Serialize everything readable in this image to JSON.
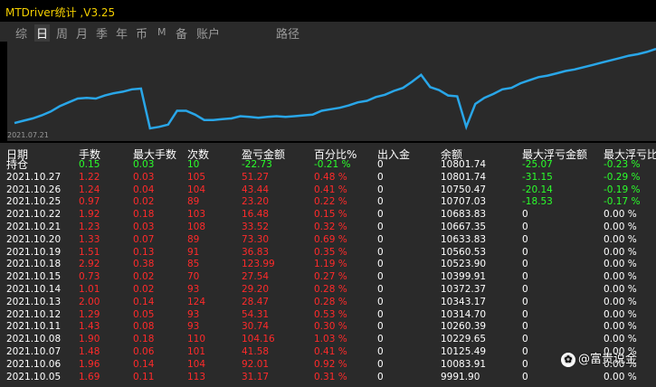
{
  "window": {
    "title": "MTDriver统计 ,V3.25"
  },
  "tabs": [
    {
      "label": "综",
      "active": false
    },
    {
      "label": "日",
      "active": true
    },
    {
      "label": "周",
      "active": false
    },
    {
      "label": "月",
      "active": false
    },
    {
      "label": "季",
      "active": false
    },
    {
      "label": "年",
      "active": false
    },
    {
      "label": "币",
      "active": false
    },
    {
      "label": "M",
      "active": false
    },
    {
      "label": "备",
      "active": false
    },
    {
      "label": "账户",
      "active": false
    },
    {
      "label": "路径",
      "active": false
    }
  ],
  "chart_data": {
    "type": "line",
    "x_start_label": "2021.07.21",
    "values": [
      1,
      1.3,
      1.6,
      2.0,
      2.5,
      3.2,
      3.7,
      4.2,
      4.3,
      4.2,
      4.6,
      4.9,
      5.1,
      5.4,
      5.5,
      0.3,
      0.5,
      0.8,
      2.6,
      2.6,
      2.1,
      1.4,
      1.4,
      1.5,
      1.6,
      1.9,
      1.8,
      1.7,
      1.8,
      1.9,
      1.8,
      1.9,
      2.0,
      2.1,
      2.6,
      2.8,
      3.0,
      3.3,
      3.7,
      3.9,
      4.4,
      4.7,
      5.2,
      5.6,
      6.4,
      7.3,
      5.7,
      5.3,
      4.6,
      4.5,
      0.5,
      3.5,
      4.3,
      4.8,
      5.4,
      5.6,
      6.2,
      6.6,
      7.0,
      7.2,
      7.5,
      7.8,
      8.0,
      8.3,
      8.6,
      8.9,
      9.2,
      9.5,
      9.8,
      10.0,
      10.3,
      10.7
    ],
    "line_color": "#29a6e8",
    "grid": false
  },
  "table": {
    "headers": [
      "日期",
      "手数",
      "最大手数",
      "次数",
      "盈亏金额",
      "百分比%",
      "出入金",
      "余额",
      "最大浮亏金额",
      "最大浮亏比"
    ],
    "rows": [
      {
        "date": "持仓",
        "lots": "0.15",
        "max_lots": "0.03",
        "count": "10",
        "pnl": "-22.73",
        "pct": "-0.21 %",
        "cash": "0",
        "balance": "10801.74",
        "max_dd": "-25.07",
        "max_dd_pct": "-0.23 %",
        "color": "green",
        "dd_color": "green"
      },
      {
        "date": "2021.10.27",
        "lots": "1.22",
        "max_lots": "0.03",
        "count": "105",
        "pnl": "51.27",
        "pct": "0.48 %",
        "cash": "0",
        "balance": "10801.74",
        "max_dd": "-31.15",
        "max_dd_pct": "-0.29 %",
        "color": "red",
        "dd_color": "green"
      },
      {
        "date": "2021.10.26",
        "lots": "1.24",
        "max_lots": "0.04",
        "count": "104",
        "pnl": "43.44",
        "pct": "0.41 %",
        "cash": "0",
        "balance": "10750.47",
        "max_dd": "-20.14",
        "max_dd_pct": "-0.19 %",
        "color": "red",
        "dd_color": "green"
      },
      {
        "date": "2021.10.25",
        "lots": "0.97",
        "max_lots": "0.02",
        "count": "89",
        "pnl": "23.20",
        "pct": "0.22 %",
        "cash": "0",
        "balance": "10707.03",
        "max_dd": "-18.53",
        "max_dd_pct": "-0.17 %",
        "color": "red",
        "dd_color": "green"
      },
      {
        "date": "2021.10.22",
        "lots": "1.92",
        "max_lots": "0.18",
        "count": "103",
        "pnl": "16.48",
        "pct": "0.15 %",
        "cash": "0",
        "balance": "10683.83",
        "max_dd": "0",
        "max_dd_pct": "0.00 %",
        "color": "red",
        "dd_color": "white"
      },
      {
        "date": "2021.10.21",
        "lots": "1.23",
        "max_lots": "0.03",
        "count": "108",
        "pnl": "33.52",
        "pct": "0.32 %",
        "cash": "0",
        "balance": "10667.35",
        "max_dd": "0",
        "max_dd_pct": "0.00 %",
        "color": "red",
        "dd_color": "white"
      },
      {
        "date": "2021.10.20",
        "lots": "1.33",
        "max_lots": "0.07",
        "count": "89",
        "pnl": "73.30",
        "pct": "0.69 %",
        "cash": "0",
        "balance": "10633.83",
        "max_dd": "0",
        "max_dd_pct": "0.00 %",
        "color": "red",
        "dd_color": "white"
      },
      {
        "date": "2021.10.19",
        "lots": "1.51",
        "max_lots": "0.13",
        "count": "91",
        "pnl": "36.83",
        "pct": "0.35 %",
        "cash": "0",
        "balance": "10560.53",
        "max_dd": "0",
        "max_dd_pct": "0.00 %",
        "color": "red",
        "dd_color": "white"
      },
      {
        "date": "2021.10.18",
        "lots": "2.92",
        "max_lots": "0.38",
        "count": "85",
        "pnl": "123.99",
        "pct": "1.19 %",
        "cash": "0",
        "balance": "10523.90",
        "max_dd": "0",
        "max_dd_pct": "0.00 %",
        "color": "red",
        "dd_color": "white"
      },
      {
        "date": "2021.10.15",
        "lots": "0.73",
        "max_lots": "0.02",
        "count": "70",
        "pnl": "27.54",
        "pct": "0.27 %",
        "cash": "0",
        "balance": "10399.91",
        "max_dd": "0",
        "max_dd_pct": "0.00 %",
        "color": "red",
        "dd_color": "white"
      },
      {
        "date": "2021.10.14",
        "lots": "1.01",
        "max_lots": "0.02",
        "count": "93",
        "pnl": "29.20",
        "pct": "0.28 %",
        "cash": "0",
        "balance": "10372.37",
        "max_dd": "0",
        "max_dd_pct": "0.00 %",
        "color": "red",
        "dd_color": "white"
      },
      {
        "date": "2021.10.13",
        "lots": "2.00",
        "max_lots": "0.14",
        "count": "124",
        "pnl": "28.47",
        "pct": "0.28 %",
        "cash": "0",
        "balance": "10343.17",
        "max_dd": "0",
        "max_dd_pct": "0.00 %",
        "color": "red",
        "dd_color": "white"
      },
      {
        "date": "2021.10.12",
        "lots": "1.29",
        "max_lots": "0.05",
        "count": "93",
        "pnl": "54.31",
        "pct": "0.53 %",
        "cash": "0",
        "balance": "10314.70",
        "max_dd": "0",
        "max_dd_pct": "0.00 %",
        "color": "red",
        "dd_color": "white"
      },
      {
        "date": "2021.10.11",
        "lots": "1.43",
        "max_lots": "0.08",
        "count": "93",
        "pnl": "30.74",
        "pct": "0.30 %",
        "cash": "0",
        "balance": "10260.39",
        "max_dd": "0",
        "max_dd_pct": "0.00 %",
        "color": "red",
        "dd_color": "white"
      },
      {
        "date": "2021.10.08",
        "lots": "1.90",
        "max_lots": "0.18",
        "count": "110",
        "pnl": "104.16",
        "pct": "1.03 %",
        "cash": "0",
        "balance": "10229.65",
        "max_dd": "0",
        "max_dd_pct": "0.00 %",
        "color": "red",
        "dd_color": "white"
      },
      {
        "date": "2021.10.07",
        "lots": "1.48",
        "max_lots": "0.06",
        "count": "101",
        "pnl": "41.58",
        "pct": "0.41 %",
        "cash": "0",
        "balance": "10125.49",
        "max_dd": "0",
        "max_dd_pct": "0.00 %",
        "color": "red",
        "dd_color": "white"
      },
      {
        "date": "2021.10.06",
        "lots": "1.96",
        "max_lots": "0.14",
        "count": "104",
        "pnl": "92.01",
        "pct": "0.92 %",
        "cash": "0",
        "balance": "10083.91",
        "max_dd": "0",
        "max_dd_pct": "0.00 %",
        "color": "red",
        "dd_color": "white"
      },
      {
        "date": "2021.10.05",
        "lots": "1.69",
        "max_lots": "0.11",
        "count": "113",
        "pnl": "31.17",
        "pct": "0.31 %",
        "cash": "0",
        "balance": "9991.90",
        "max_dd": "0",
        "max_dd_pct": "0.00 %",
        "color": "red",
        "dd_color": "white"
      }
    ]
  },
  "watermark": {
    "icon": "paw-icon",
    "text": "@富贵说金"
  }
}
